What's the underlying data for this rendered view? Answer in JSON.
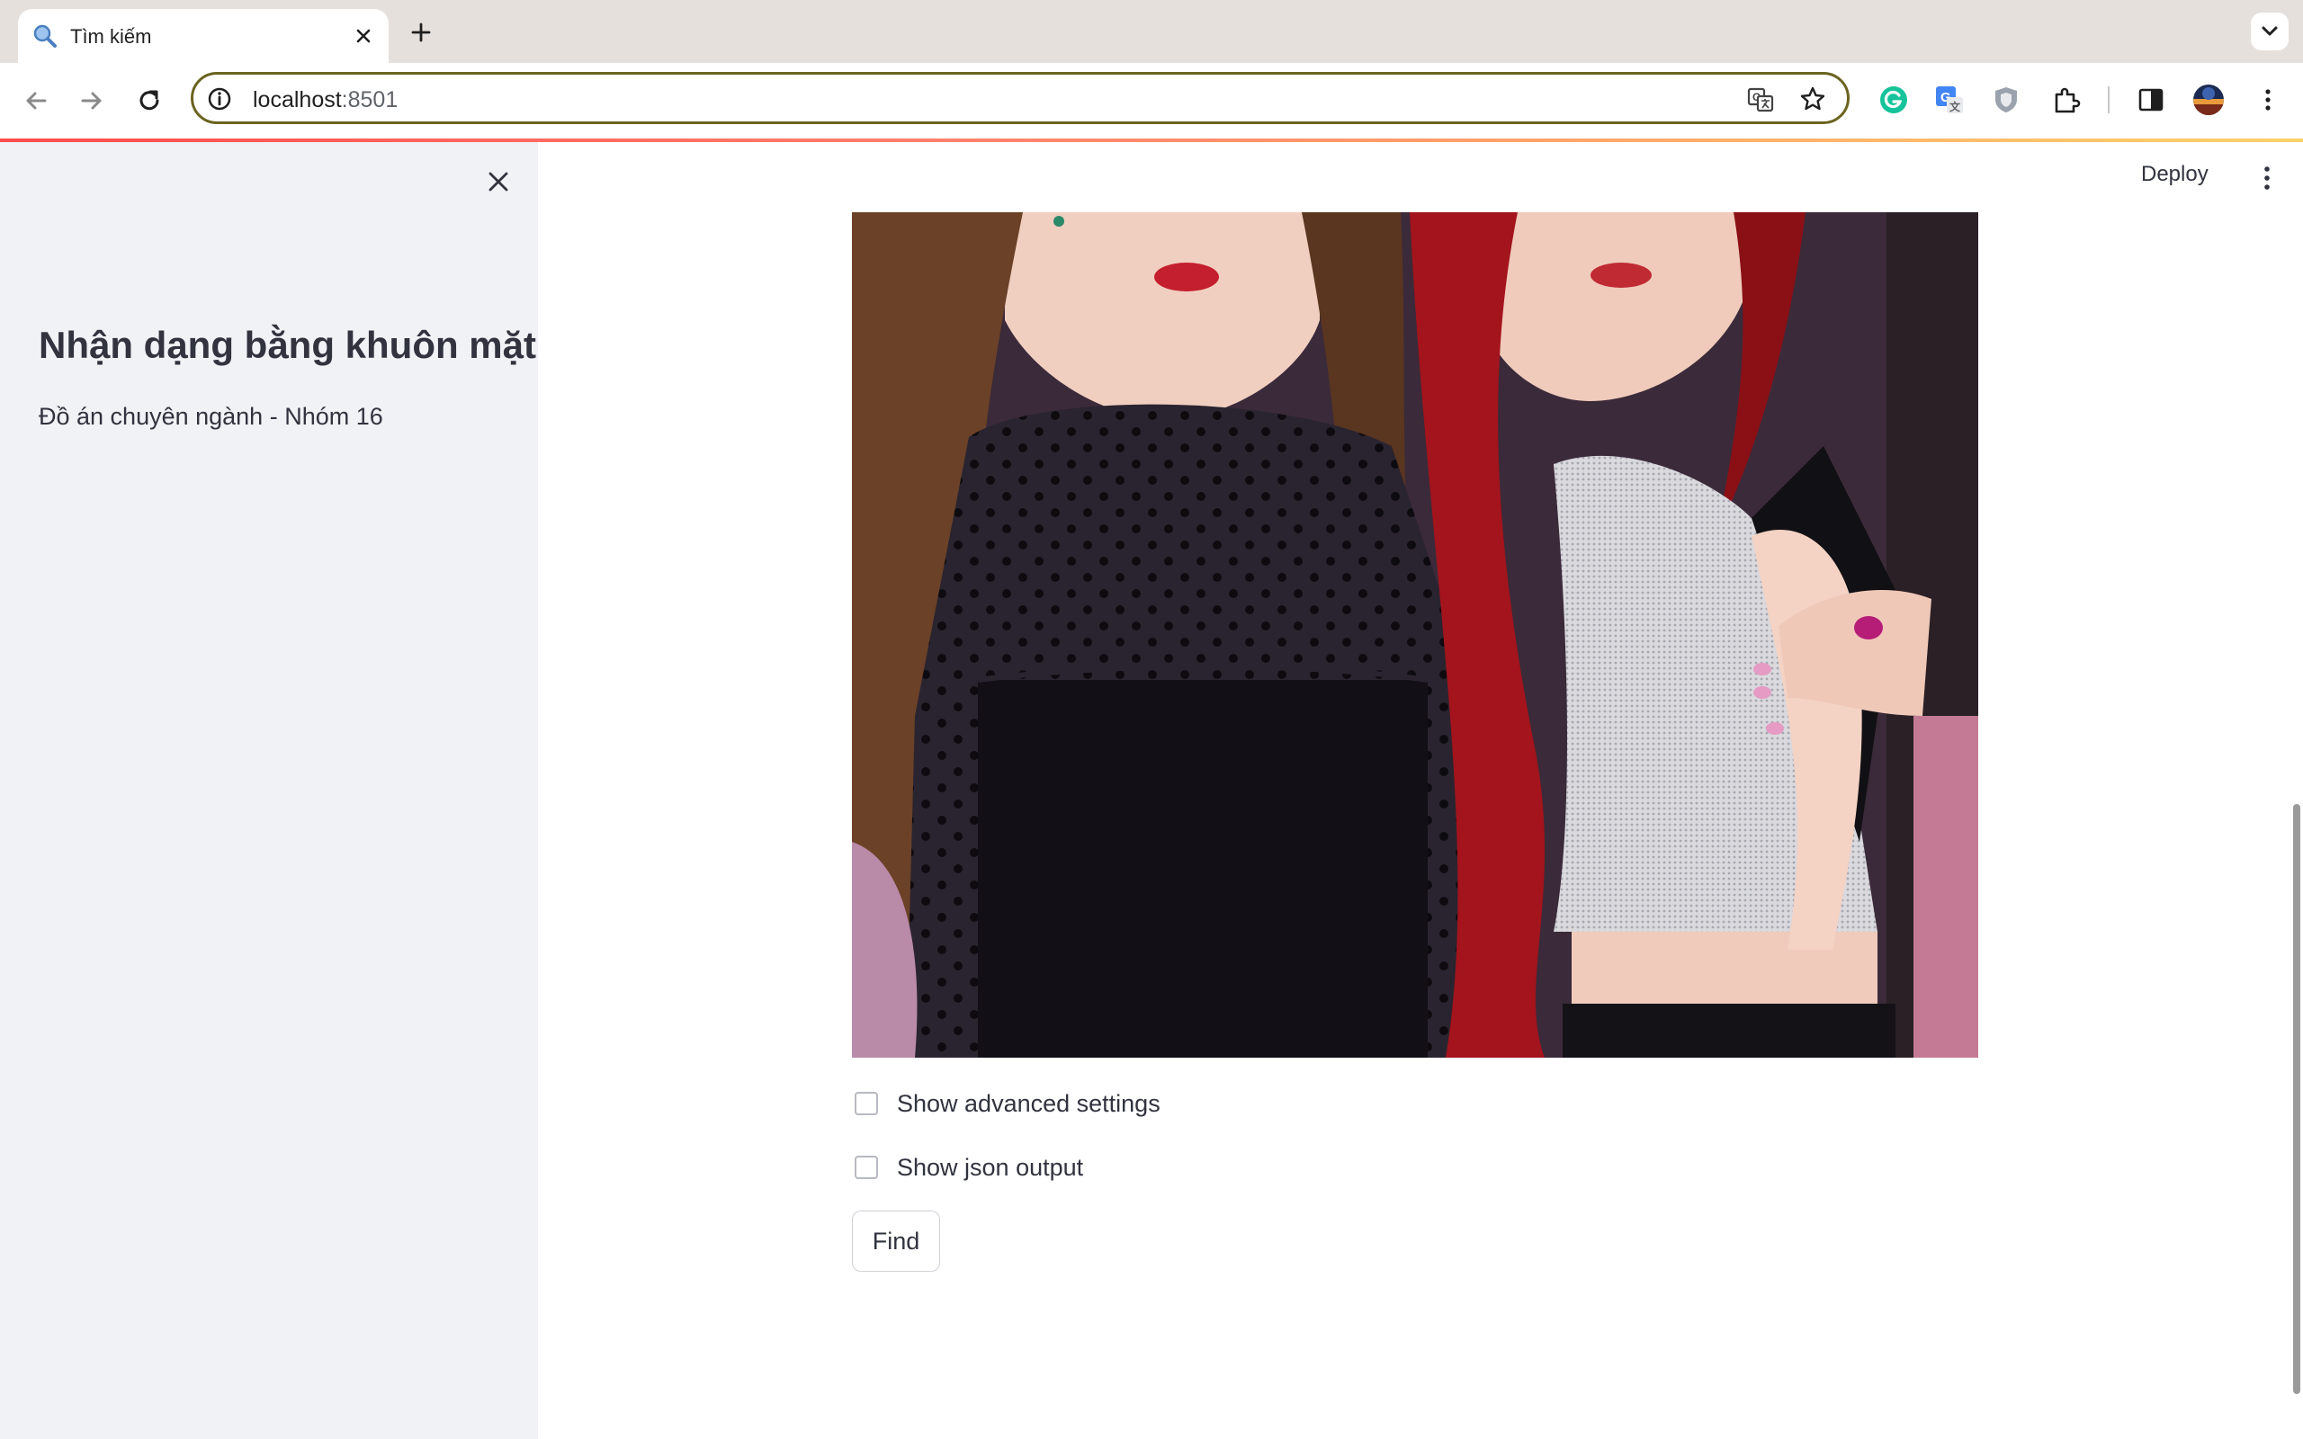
{
  "browser": {
    "tab_title": "Tìm kiếm",
    "url_host": "localhost",
    "url_port": ":8501"
  },
  "app": {
    "deploy_label": "Deploy",
    "sidebar": {
      "title": "Nhận dạng bằng khuôn mặt",
      "subtitle": "Đồ án chuyên ngành - Nhóm 16"
    },
    "main": {
      "checkbox_advanced": {
        "label": "Show advanced settings",
        "checked": false
      },
      "checkbox_json": {
        "label": "Show json output",
        "checked": false
      },
      "find_button": "Find"
    }
  },
  "colors": {
    "accent_red": "#ff4b4b",
    "sidebar_bg": "#f0f2f6",
    "text": "#31333f",
    "omnibox_border": "#6b6420"
  }
}
